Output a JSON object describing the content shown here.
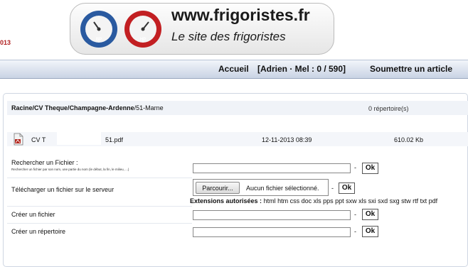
{
  "header": {
    "site_url": "www.frigoristes.fr",
    "tagline": "Le site des frigoristes",
    "gauge_low_label": "BP",
    "gauge_high_label": "HP",
    "year_fragment": "013"
  },
  "nav": {
    "home": "Accueil",
    "user_status": "[Adrien · Mel : 0 / 590]",
    "submit_article": "Soumettre un article"
  },
  "browser": {
    "breadcrumb": {
      "root": "Racine",
      "sep": "/",
      "cv": "CV Theque",
      "region": "Champagne-Ardenne",
      "current": "/51-Marne"
    },
    "dir_count": "0 répertoire(s)",
    "files": [
      {
        "name_start": "CV T",
        "name_end": "51.pdf",
        "date": "12-11-2013 08:39",
        "size": "610.02 Kb"
      }
    ]
  },
  "forms": {
    "search": {
      "label": "Rechercher un Fichier :",
      "hint": "Rechercher un fichier par son nom, une partie du nom (le début, la fin, le milieu, ...)",
      "value": "",
      "dash": "-",
      "ok": "Ok"
    },
    "upload": {
      "label": "Télécharger un fichier sur le serveur",
      "browse": "Parcourir...",
      "no_file": "Aucun fichier sélectionné.",
      "dash": "-",
      "ok": "Ok",
      "ext_label": "Extensions autorisées :",
      "ext_list": "html htm css doc xls pps ppt sxw xls sxi sxd sxg stw rtf txt pdf"
    },
    "create_file": {
      "label": "Créer un fichier",
      "value": "",
      "dash": "-",
      "ok": "Ok"
    },
    "create_dir": {
      "label": "Créer un répertoire",
      "value": "",
      "dash": "-",
      "ok": "Ok"
    }
  },
  "colors": {
    "gauge_low": "#2a5aa0",
    "gauge_high": "#c21f22",
    "nav_bar": "#c9d3e4",
    "pdf_icon": "#b3261e"
  }
}
